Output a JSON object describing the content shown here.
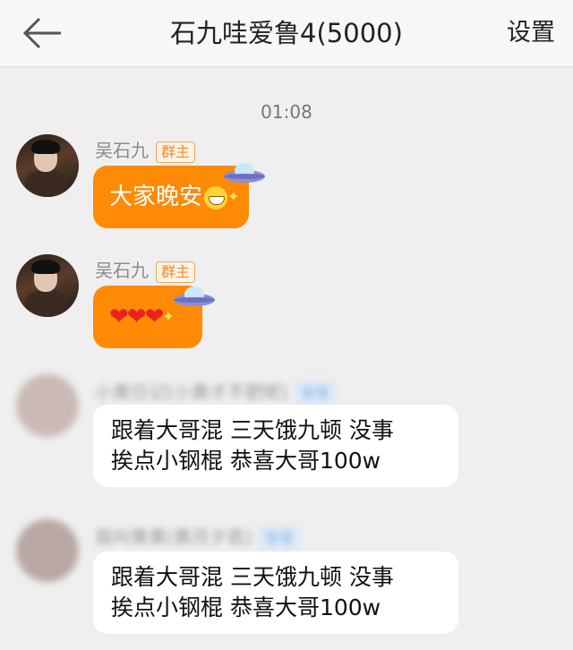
{
  "header": {
    "title": "石九哇爱鲁4(5000)",
    "settings_label": "设置"
  },
  "timestamp": "01:08",
  "messages": [
    {
      "sender": "吴石九",
      "badge": "群主",
      "text": "大家晚安",
      "emoji": "grin-emoji",
      "decoration": "ufo-sticker"
    },
    {
      "sender": "吴石九",
      "badge": "群主",
      "text": "❤❤❤",
      "decoration": "ufo-sticker"
    },
    {
      "sender": "小黄日记(小黄才不肥呢)",
      "badge": "管理",
      "line1": "跟着大哥混 三天饿九顿 没事",
      "line2": "挨点小钢棍 恭喜大哥100w"
    },
    {
      "sender": "我叫黄黄(黄月夕若)",
      "badge": "管理",
      "line1": "跟着大哥混 三天饿九顿 没事",
      "line2": "挨点小钢棍 恭喜大哥100w"
    }
  ],
  "colors": {
    "orange_bubble": "#fe8a05",
    "owner_badge": "#f08a2c",
    "background": "#efefef"
  }
}
